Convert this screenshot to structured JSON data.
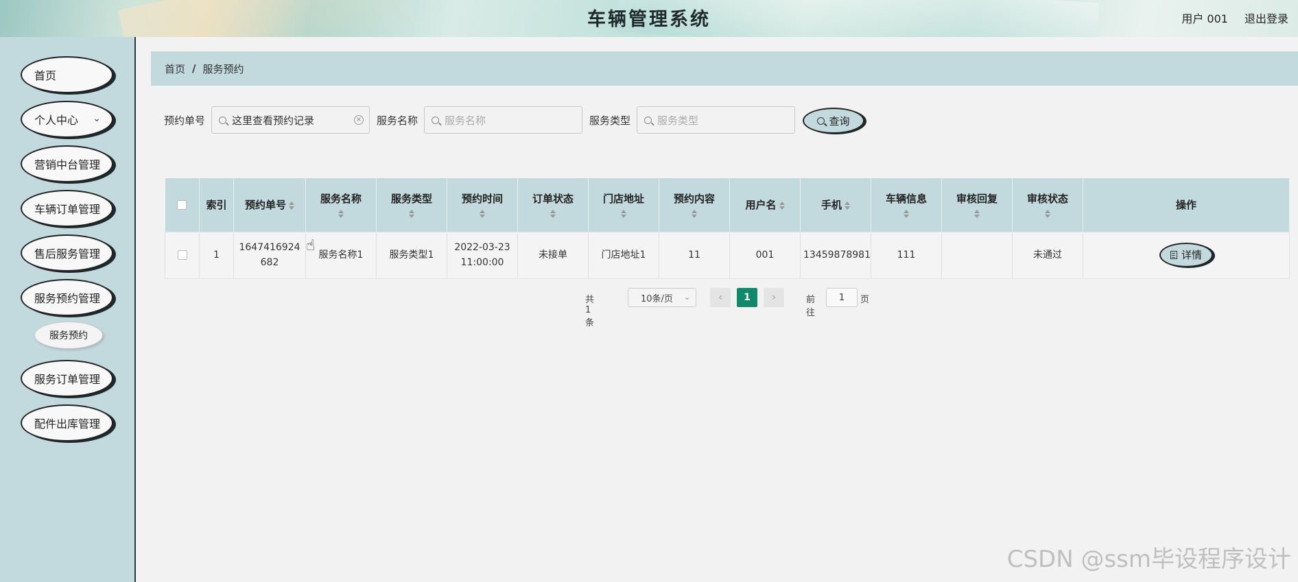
{
  "header": {
    "title": "车辆管理系统",
    "user_label": "用户 001",
    "logout_label": "退出登录"
  },
  "sidebar": {
    "items": [
      {
        "label": "首页"
      },
      {
        "label": "个人中心",
        "has_chevron": true
      },
      {
        "label": "营销中台管理"
      },
      {
        "label": "车辆订单管理"
      },
      {
        "label": "售后服务管理"
      },
      {
        "label": "服务预约管理"
      },
      {
        "label": "服务订单管理"
      },
      {
        "label": "配件出库管理"
      }
    ],
    "submenu": {
      "label": "服务预约"
    }
  },
  "breadcrumb": {
    "home": "首页",
    "separator": "/",
    "current": "服务预约"
  },
  "search": {
    "order_no_label": "预约单号",
    "order_no_value": "这里查看预约记录",
    "service_name_label": "服务名称",
    "service_name_placeholder": "服务名称",
    "service_type_label": "服务类型",
    "service_type_placeholder": "服务类型",
    "query_button": "查询"
  },
  "table": {
    "headers": [
      "索引",
      "预约单号",
      "服务名称",
      "服务类型",
      "预约时间",
      "订单状态",
      "门店地址",
      "预约内容",
      "用户名",
      "手机",
      "车辆信息",
      "审核回复",
      "审核状态",
      "操作"
    ],
    "rows": [
      {
        "index": "1",
        "order_no": "1647416924682",
        "service_name": "服务名称1",
        "service_type": "服务类型1",
        "time": "2022-03-23 11:00:00",
        "order_status": "未接单",
        "store_address": "门店地址1",
        "content": "11",
        "username": "001",
        "phone": "13459878981",
        "vehicle": "111",
        "review_reply": "",
        "review_status": "未通过",
        "action": "详情"
      }
    ]
  },
  "pagination": {
    "total_text": "共 1 条",
    "page_size": "10条/页",
    "current_page": "1",
    "goto_label": "前往",
    "goto_value": "1",
    "page_suffix": "页"
  },
  "watermark": "CSDN @ssm毕设程序设计",
  "colors": {
    "accent": "#c2d9de",
    "active_page": "#118a6b"
  }
}
